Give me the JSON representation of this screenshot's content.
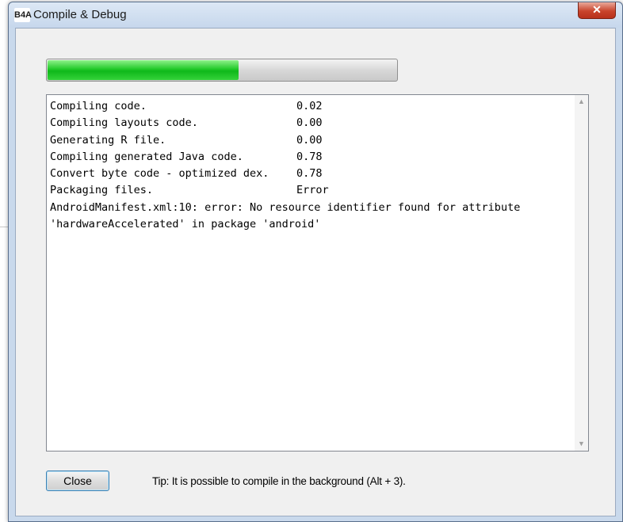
{
  "window": {
    "title": "Compile & Debug",
    "app_icon_label": "B4A",
    "close_glyph": "✕"
  },
  "progress": {
    "value_percent": 55,
    "fill_color": "#22c92a"
  },
  "log": {
    "steps": [
      {
        "label": "Compiling code.",
        "value": "0.02"
      },
      {
        "label": "Compiling layouts code.",
        "value": "0.00"
      },
      {
        "label": "Generating R file.",
        "value": "0.00"
      },
      {
        "label": "Compiling generated Java code.",
        "value": "0.78"
      },
      {
        "label": "Convert byte code - optimized dex.",
        "value": "0.78"
      },
      {
        "label": "Packaging files.",
        "value": "Error"
      }
    ],
    "error_line_1": "AndroidManifest.xml:10: error: No resource identifier found for attribute",
    "error_line_2": "'hardwareAccelerated' in package 'android'",
    "scroll_up_glyph": "▲",
    "scroll_down_glyph": "▼"
  },
  "footer": {
    "close_label": "Close",
    "tip": "Tip: It is possible to compile in the background (Alt + 3)."
  }
}
